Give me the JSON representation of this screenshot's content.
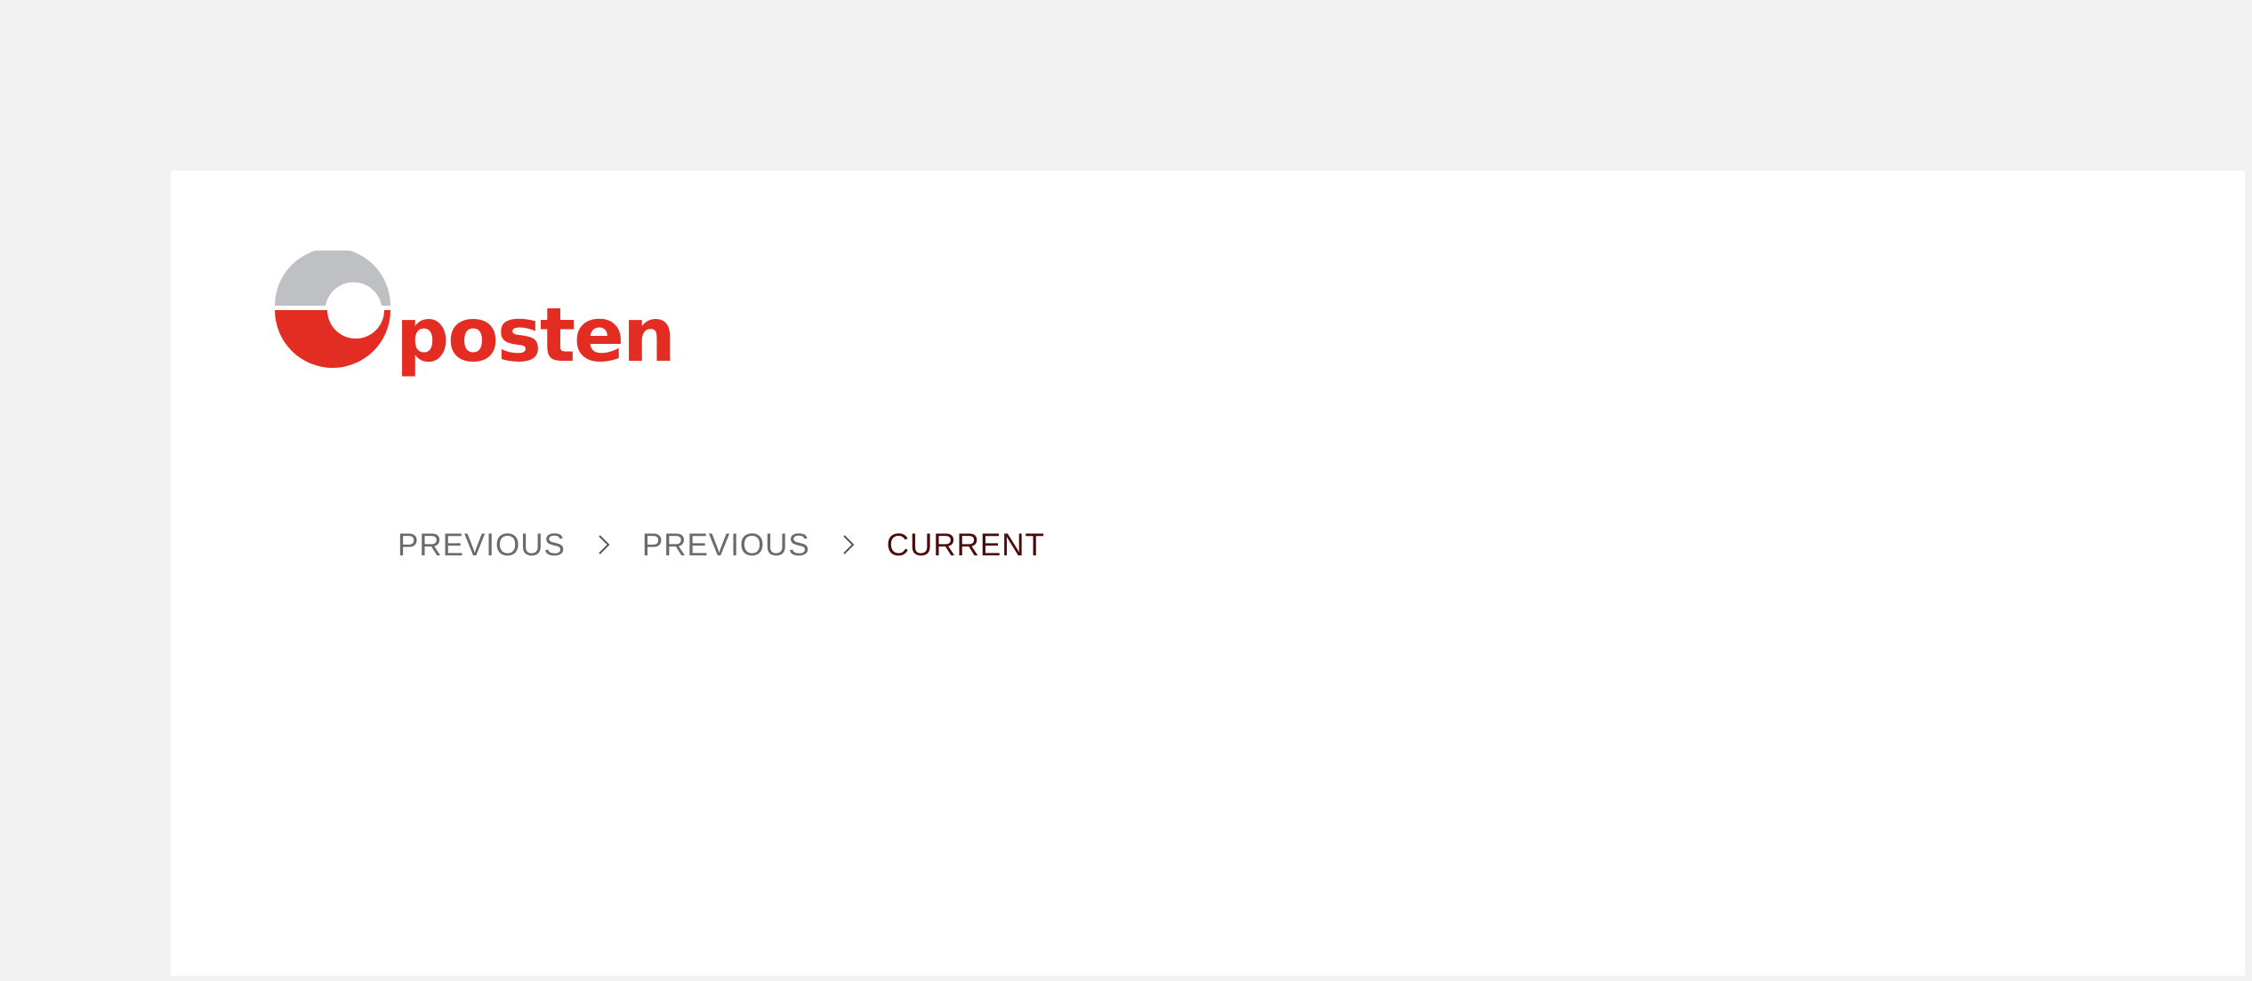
{
  "brand": {
    "name": "posten",
    "colors": {
      "red": "#e32d22",
      "grey": "#bfc0c3"
    }
  },
  "breadcrumb": {
    "separator_icon": "chevron-right-icon",
    "items": [
      {
        "label": "PREVIOUS"
      },
      {
        "label": "PREVIOUS"
      },
      {
        "label": "CURRENT"
      }
    ]
  },
  "colors": {
    "background": "#f2f2f2",
    "panel": "#ffffff",
    "link_text": "#6b6b6b",
    "current_text": "#4a0b0b"
  }
}
